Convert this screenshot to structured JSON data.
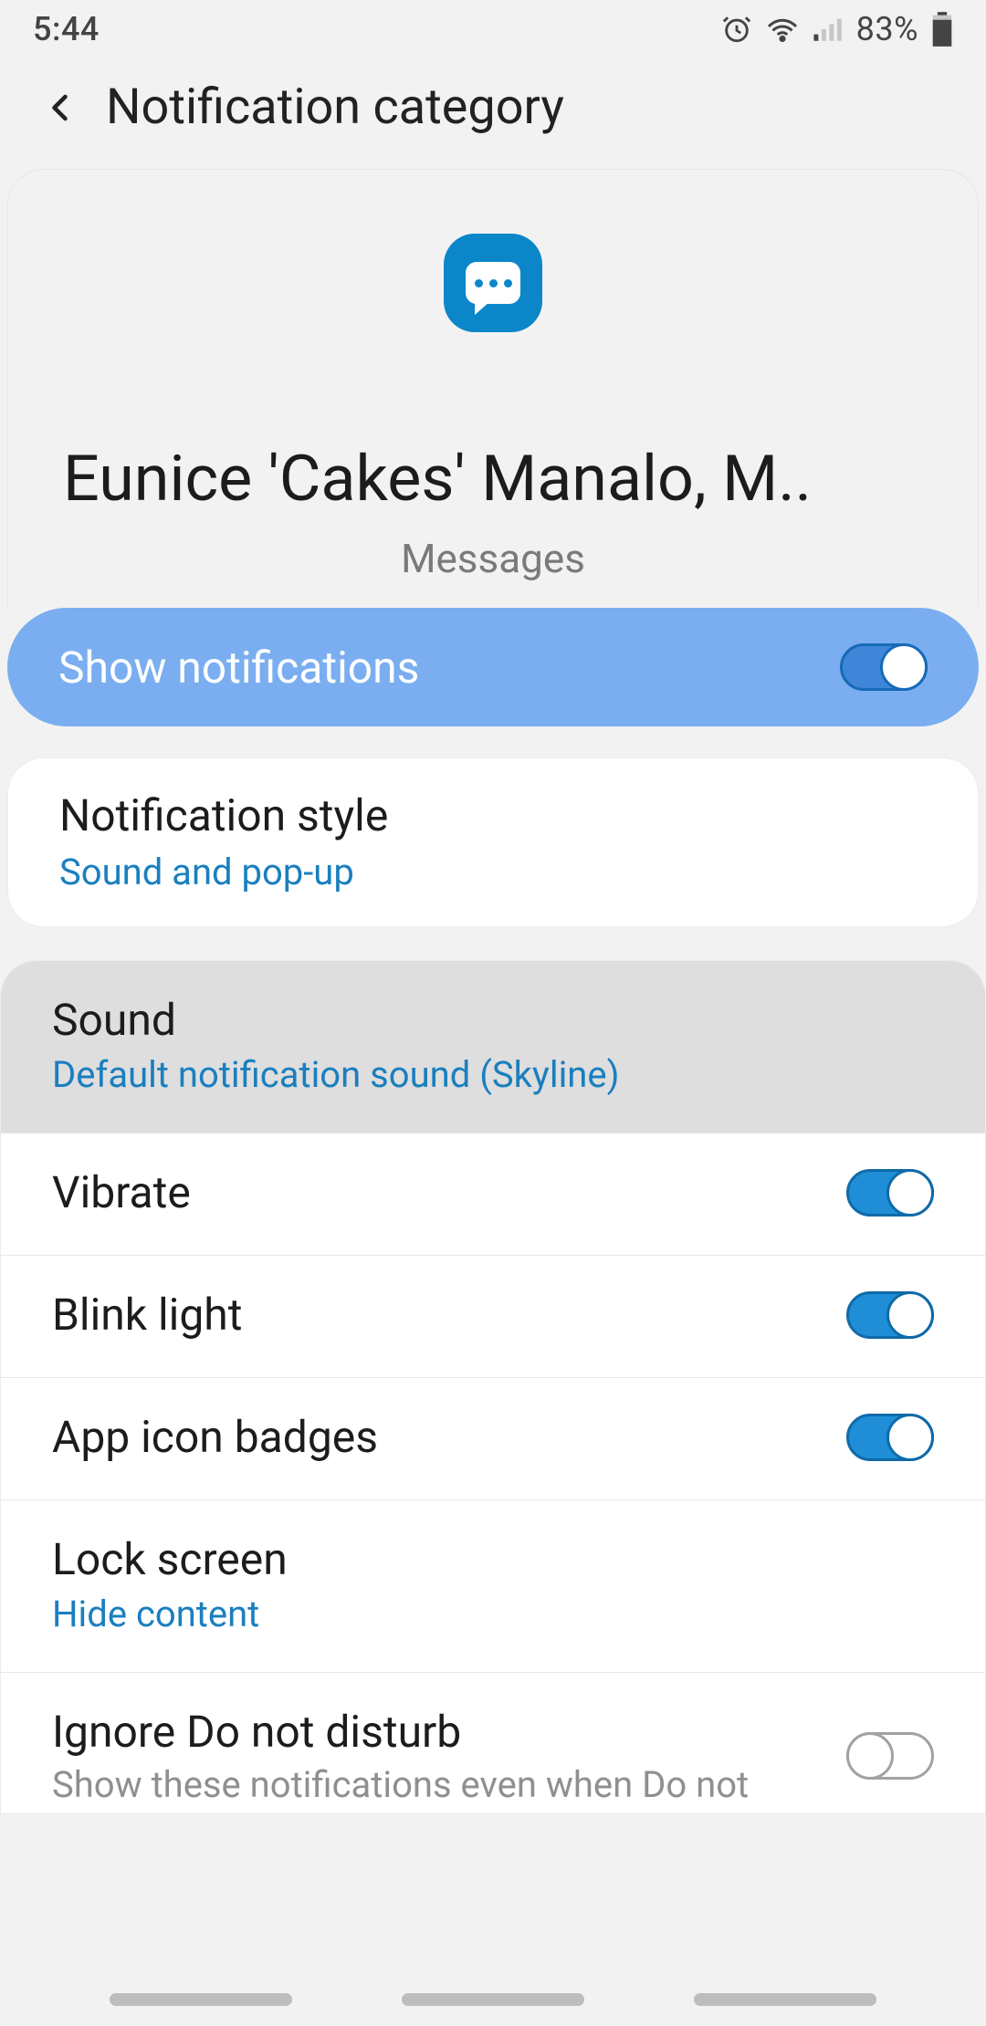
{
  "status": {
    "time": "5:44",
    "battery": "83%"
  },
  "header": {
    "title": "Notification category"
  },
  "hero": {
    "contact_name": "Eunice 'Cakes' Manalo, M..",
    "app_label": "Messages"
  },
  "pill": {
    "label": "Show notifications",
    "state": true
  },
  "style_row": {
    "title": "Notification style",
    "sub": "Sound and pop-up"
  },
  "rows": {
    "sound": {
      "title": "Sound",
      "sub": "Default notification sound (Skyline)"
    },
    "vibrate": {
      "title": "Vibrate",
      "state": true
    },
    "blink": {
      "title": "Blink light",
      "state": true
    },
    "badges": {
      "title": "App icon badges",
      "state": true
    },
    "lock": {
      "title": "Lock screen",
      "sub": "Hide content"
    },
    "dnd": {
      "title": "Ignore Do not disturb",
      "sub": "Show these notifications even when Do not",
      "state": false
    }
  }
}
